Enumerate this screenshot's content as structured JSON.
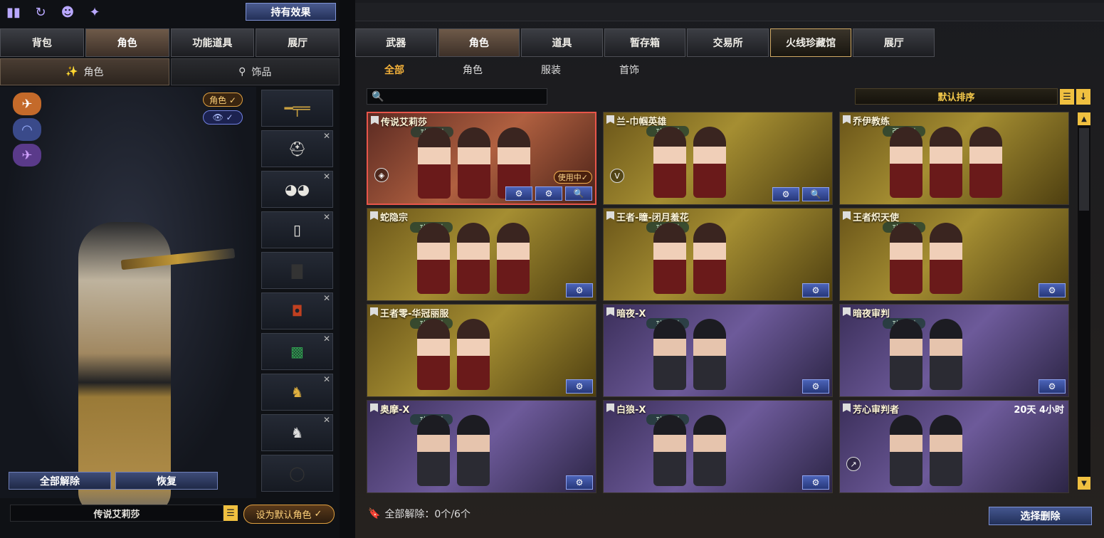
{
  "left": {
    "top_icons": [
      "stats-icon",
      "history-icon",
      "character-icon",
      "mouse-icon"
    ],
    "effects_button": "持有效果",
    "tabs": [
      "背包",
      "角色",
      "功能道具",
      "展厅"
    ],
    "active_tab": 1,
    "subtabs": [
      {
        "icon": "✨",
        "label": "角色"
      },
      {
        "icon": "⚲",
        "label": "饰品"
      }
    ],
    "pills": {
      "role": "角色 ✓",
      "eye": "👁 ✓"
    },
    "unequip_all": "全部解除",
    "restore": "恢复",
    "selected_name": "传说艾莉莎",
    "set_default": "设为默认角色",
    "set_default_check": "✓"
  },
  "right": {
    "tabs": [
      "武器",
      "角色",
      "道具",
      "暂存箱",
      "交易所",
      "火线珍藏馆",
      "展厅"
    ],
    "active_tab": 1,
    "filters": [
      "全部",
      "角色",
      "服装",
      "首饰"
    ],
    "search_placeholder": "",
    "sort_label": "默认排序",
    "sort_menu": "☰",
    "sort_dir": "↓",
    "cards": [
      {
        "name": "传说艾莉莎",
        "type": "功能型",
        "style": "sel",
        "faces": 3,
        "using": "使用中✓",
        "badge": "◈",
        "acts": [
          "⚙",
          "⚙",
          "🔍"
        ]
      },
      {
        "name": "兰-巾帼英雄",
        "type": "功能型",
        "style": "gold",
        "faces": 2,
        "badge": "V",
        "acts": [
          "⚙",
          "🔍"
        ]
      },
      {
        "name": "乔伊教练",
        "type": "强化型",
        "style": "gold",
        "faces": 3,
        "acts": []
      },
      {
        "name": "蛇隐宗",
        "type": "功能型",
        "style": "gold",
        "faces": 3,
        "acts": [
          "⚙"
        ]
      },
      {
        "name": "王者-瞳-闭月羞花",
        "type": "功能型",
        "style": "gold",
        "faces": 2,
        "acts": [
          "⚙"
        ]
      },
      {
        "name": "王者炽天使",
        "type": "功能型",
        "style": "gold",
        "faces": 2,
        "acts": [
          "⚙"
        ]
      },
      {
        "name": "王者零-华冠丽服",
        "type": "功能型",
        "style": "gold",
        "faces": 2,
        "acts": [
          "⚙"
        ]
      },
      {
        "name": "暗夜-X",
        "type": "功能型",
        "style": "purple",
        "faces": 2,
        "acts": [
          "⚙"
        ]
      },
      {
        "name": "暗夜审判",
        "type": "功能型",
        "style": "purple",
        "faces": 2,
        "acts": [
          "⚙"
        ]
      },
      {
        "name": "奥摩-X",
        "type": "功能型",
        "style": "purple",
        "faces": 2,
        "acts": [
          "⚙"
        ]
      },
      {
        "name": "白狼-X",
        "type": "功能型",
        "style": "purple",
        "faces": 2,
        "acts": [
          "⚙"
        ]
      },
      {
        "name": "芳心审判者",
        "type": "",
        "style": "purple",
        "faces": 2,
        "timer": "20天 4小时",
        "badge": "↗",
        "acts": []
      }
    ],
    "unequip_status": "全部解除：0个/6个",
    "delete_button": "选择删除"
  }
}
